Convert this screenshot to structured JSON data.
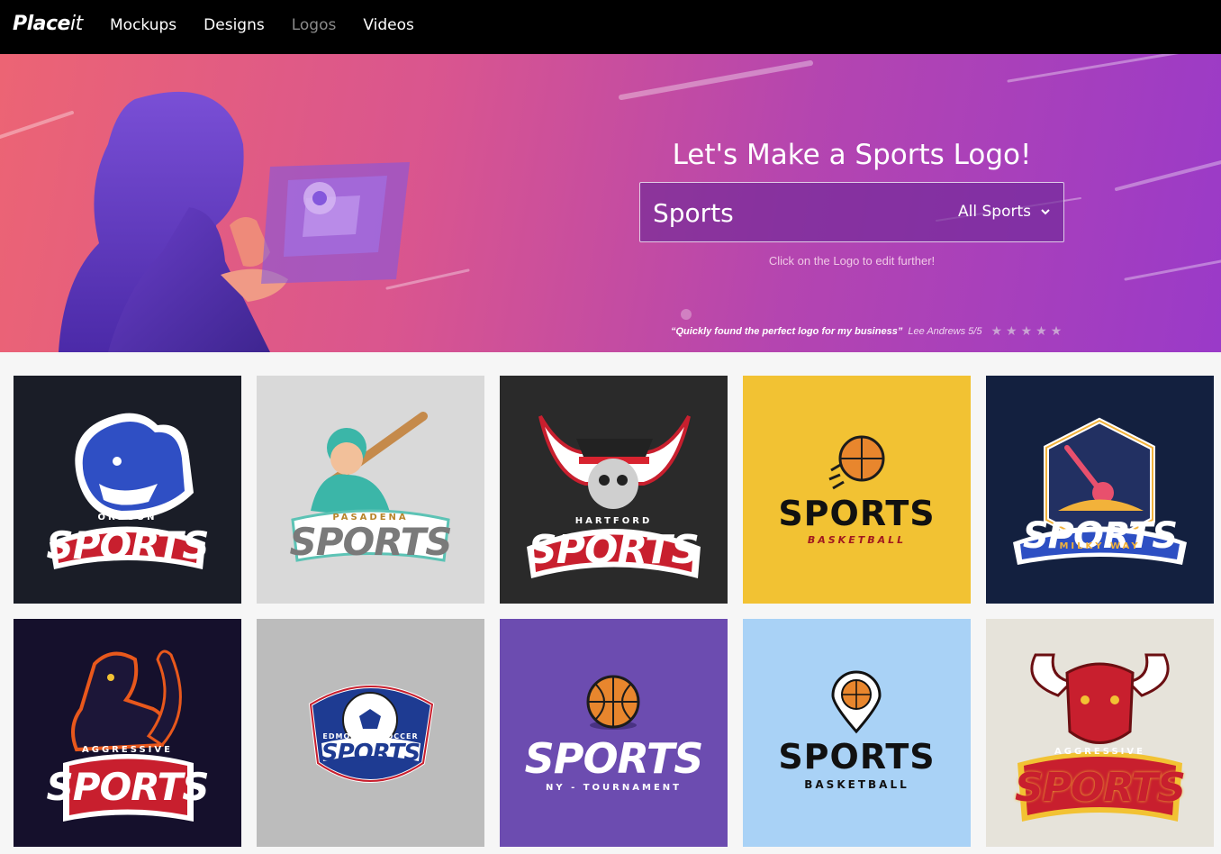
{
  "nav": {
    "brand_bold": "Place",
    "brand_light": "it",
    "links": [
      "Mockups",
      "Designs",
      "Logos",
      "Videos"
    ]
  },
  "hero": {
    "title": "Let's Make a Sports Logo!",
    "search_value": "Sports",
    "select_value": "All Sports",
    "hint": "Click on the Logo to edit further!",
    "quote": "“Quickly found the perfect logo for my business”",
    "quote_author": "Lee Andrews 5/5",
    "stars": 5
  },
  "tiles": [
    {
      "title": "SPORTS",
      "sub": "OREGON",
      "bg": "#1a1d27",
      "icon": "bear-mascot-icon"
    },
    {
      "title": "SPORTS",
      "sub": "PASADENA",
      "bg": "#d9d9d9",
      "icon": "baseball-player-icon"
    },
    {
      "title": "SPORTS",
      "sub": "HARTFORD",
      "bg": "#2a2a2a",
      "icon": "pirate-skull-icon"
    },
    {
      "title": "SPORTS",
      "sub": "BASKETBALL",
      "bg": "#f2c233",
      "icon": "basketball-icon"
    },
    {
      "title": "SPORTS",
      "sub": "MILKY WAY",
      "bg": "#13203f",
      "icon": "meteor-badge-icon"
    },
    {
      "title": "SPORTS",
      "sub": "AGGRESSIVE",
      "bg": "#15102c",
      "icon": "panther-mascot-icon"
    },
    {
      "title": "SPORTS",
      "sub": "EDMONTON SOCCER",
      "bg": "#bcbcbc",
      "icon": "soccer-shield-icon"
    },
    {
      "title": "SPORTS",
      "sub": "NY - TOURNAMENT",
      "bg": "#6c4cb0",
      "icon": "basketball-icon"
    },
    {
      "title": "SPORTS",
      "sub": "BASKETBALL",
      "bg": "#a9d2f6",
      "icon": "location-pin-basketball-icon"
    },
    {
      "title": "SPORTS",
      "sub": "AGGRESSIVE",
      "bg": "#e6e3da",
      "icon": "bull-mascot-icon"
    }
  ]
}
